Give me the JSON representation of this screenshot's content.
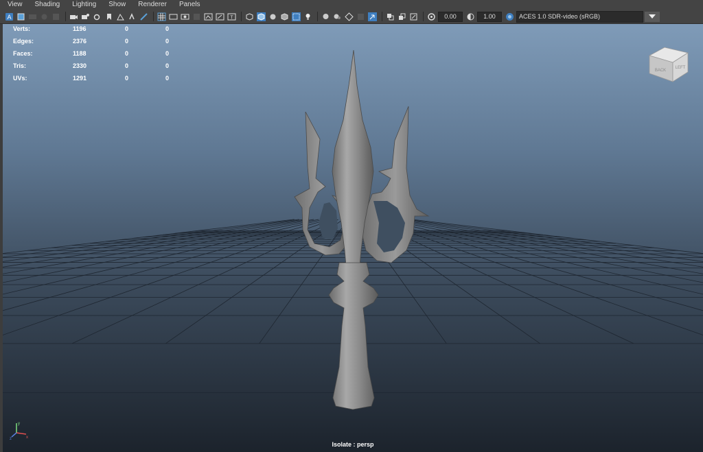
{
  "menubar": {
    "items": [
      {
        "label": "View"
      },
      {
        "label": "Shading"
      },
      {
        "label": "Lighting"
      },
      {
        "label": "Show"
      },
      {
        "label": "Renderer"
      },
      {
        "label": "Panels"
      }
    ]
  },
  "toolbar": {
    "exposure_value": "0.00",
    "gamma_value": "1.00",
    "color_management": "ACES 1.0 SDR-video (sRGB)"
  },
  "stats": {
    "rows": [
      {
        "label": "Verts:",
        "value": "1196",
        "sel": "0",
        "sel2": "0"
      },
      {
        "label": "Edges:",
        "value": "2376",
        "sel": "0",
        "sel2": "0"
      },
      {
        "label": "Faces:",
        "value": "1188",
        "sel": "0",
        "sel2": "0"
      },
      {
        "label": "Tris:",
        "value": "2330",
        "sel": "0",
        "sel2": "0"
      },
      {
        "label": "UVs:",
        "value": "1291",
        "sel": "0",
        "sel2": "0"
      }
    ]
  },
  "viewcube": {
    "back_label": "BACK",
    "left_label": "LEFT"
  },
  "camera": {
    "label": "Isolate : persp"
  },
  "axis": {
    "x": "x",
    "y": "y",
    "z": "z"
  },
  "colors": {
    "accent": "#5aa0d8",
    "ui_bg": "#444444",
    "field_bg": "#2b2b2b"
  }
}
